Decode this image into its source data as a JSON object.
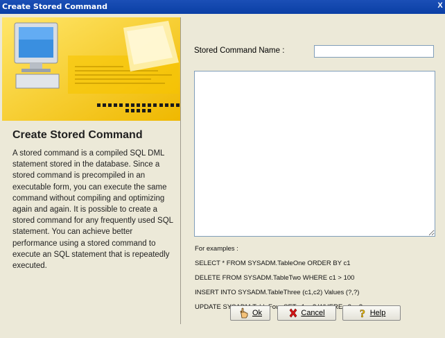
{
  "window": {
    "title": "Create Stored Command",
    "close_glyph": "X"
  },
  "left": {
    "heading": "Create Stored Command",
    "description": "A stored command is a compiled SQL DML statement stored in the database. Since a stored command is precompiled in an executable form, you can execute the same command without compiling and optimizing again and again. It is possible to create a stored command for any frequently used SQL statement. You can achieve better performance using a stored command to execute an SQL statement that is repeatedly executed."
  },
  "form": {
    "name_label": "Stored Command Name :",
    "name_value": "",
    "sql_value": ""
  },
  "examples": {
    "header": "For examples :",
    "items": [
      "SELECT * FROM SYSADM.TableOne ORDER BY c1",
      "DELETE FROM SYSADM.TableTwo WHERE c1 > 100",
      "INSERT INTO SYSADM.TableThree (c1,c2) Values (?,?)",
      "UPDATE SYSADM.TableFour SET c1 = ? WHERE c2 = ?"
    ]
  },
  "buttons": {
    "ok": "Ok",
    "cancel": "Cancel",
    "help": "Help"
  },
  "icons": {
    "ok": "hand-icon",
    "cancel": "red-x-icon",
    "help": "question-icon"
  }
}
